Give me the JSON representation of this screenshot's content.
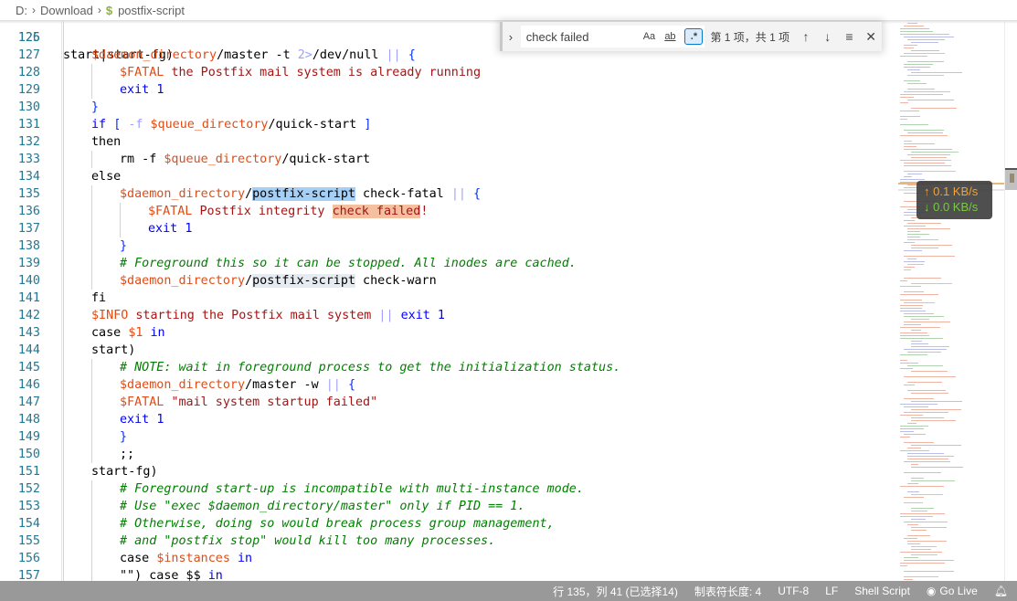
{
  "breadcrumb": {
    "items": [
      "D:",
      "Download"
    ],
    "file_icon": "$",
    "file_name": "postfix-script"
  },
  "find": {
    "value": "check failed",
    "match_case_label": "Aa",
    "whole_word_label": "ab",
    "regex_label": ".*",
    "count": "第 1 项，共 1 项"
  },
  "editor": {
    "partial_top": "start|start-fg)",
    "lines": [
      {
        "n": "126",
        "indent": 1,
        "html": ""
      },
      {
        "n": "127",
        "indent": 1,
        "html": "<span class='var'>$daemon_directory</span>/master -t <span class='op'>2&gt;</span>/dev/null <span class='op'>||</span> <span class='brk'>{</span>"
      },
      {
        "n": "128",
        "indent": 2,
        "html": "<span class='var'>$FATAL</span> <span class='str'>the Postfix mail system is already running</span>"
      },
      {
        "n": "129",
        "indent": 2,
        "html": "<span class='kw'>exit</span> <span class='kw'>1</span>"
      },
      {
        "n": "130",
        "indent": 1,
        "html": "<span class='brk'>}</span>"
      },
      {
        "n": "131",
        "indent": 1,
        "html": "<span class='kw'>if</span> <span class='brk'>[</span> <span class='op'>-f</span> <span class='var'>$queue_directory</span>/quick-start <span class='brk'>]</span>"
      },
      {
        "n": "132",
        "indent": 1,
        "html": "then"
      },
      {
        "n": "133",
        "indent": 2,
        "html": "rm -f <span class='var'>$queue_directory</span>/quick-start"
      },
      {
        "n": "134",
        "indent": 1,
        "html": "else"
      },
      {
        "n": "135",
        "indent": 2,
        "html": "<span class='var'>$daemon_directory</span>/<span class='selc'>postfix-script</span> check-fatal <span class='op'>||</span> <span class='brk'>{</span>"
      },
      {
        "n": "136",
        "indent": 3,
        "html": "<span class='var'>$FATAL</span> <span class='str'>Postfix integrity </span><span class='str match'>check failed</span><span class='str'>!</span>"
      },
      {
        "n": "137",
        "indent": 3,
        "html": "<span class='kw'>exit</span> <span class='kw'>1</span>"
      },
      {
        "n": "138",
        "indent": 2,
        "html": "<span class='brk'>}</span>"
      },
      {
        "n": "139",
        "indent": 2,
        "html": "<span class='cm'># Foreground this so it can be stopped. All inodes are cached.</span>"
      },
      {
        "n": "140",
        "indent": 2,
        "html": "<span class='var'>$daemon_directory</span>/<span class='selw'>postfix-script</span> check-warn"
      },
      {
        "n": "141",
        "indent": 1,
        "html": "fi"
      },
      {
        "n": "142",
        "indent": 1,
        "html": "<span class='var'>$INFO</span> <span class='str'>starting the Postfix mail system</span> <span class='op'>||</span> <span class='kw'>exit</span> <span class='kw'>1</span>"
      },
      {
        "n": "143",
        "indent": 1,
        "html": "case <span class='var'>$1</span> <span class='kw'>in</span>"
      },
      {
        "n": "144",
        "indent": 1,
        "html": "start)"
      },
      {
        "n": "145",
        "indent": 2,
        "html": "<span class='cm'># NOTE: wait in foreground process to get the initialization status.</span>"
      },
      {
        "n": "146",
        "indent": 2,
        "html": "<span class='var'>$daemon_directory</span>/master -w <span class='op'>||</span> <span class='brk'>{</span>"
      },
      {
        "n": "147",
        "indent": 2,
        "html": "<span class='var'>$FATAL</span> <span class='str'>\"mail system startup failed\"</span>"
      },
      {
        "n": "148",
        "indent": 2,
        "html": "<span class='kw'>exit</span> <span class='kw'>1</span>"
      },
      {
        "n": "149",
        "indent": 2,
        "html": "<span class='brk'>}</span>"
      },
      {
        "n": "150",
        "indent": 2,
        "html": ";;"
      },
      {
        "n": "151",
        "indent": 1,
        "html": "start-fg)"
      },
      {
        "n": "152",
        "indent": 2,
        "html": "<span class='cm'># Foreground start-up is incompatible with multi-instance mode.</span>"
      },
      {
        "n": "153",
        "indent": 2,
        "html": "<span class='cm'># Use \"exec $daemon_directory/master\" only if PID == 1.</span>"
      },
      {
        "n": "154",
        "indent": 2,
        "html": "<span class='cm'># Otherwise, doing so would break process group management,</span>"
      },
      {
        "n": "155",
        "indent": 2,
        "html": "<span class='cm'># and \"postfix stop\" would kill too many processes.</span>"
      },
      {
        "n": "156",
        "indent": 2,
        "html": "case <span class='var'>$instances</span> <span class='kw'>in</span>"
      },
      {
        "n": "157",
        "indent": 2,
        "html": "\"\") case $$ <span class='kw'>in</span>"
      }
    ]
  },
  "network": {
    "up": "↑ 0.1 KB/s",
    "down": "↓ 0.0 KB/s"
  },
  "status": {
    "position": "行 135，列 41 (已选择14)",
    "tab_size": "制表符长度: 4",
    "encoding": "UTF-8",
    "eol": "LF",
    "language": "Shell Script",
    "go_live": "Go Live"
  },
  "colors": {
    "status_bar": "#999999",
    "line_number": "#237893",
    "variable": "#e24c14",
    "keyword": "#0000ff",
    "comment": "#008000",
    "find_match": "#f5c0a0",
    "selection": "#a6cff5"
  }
}
